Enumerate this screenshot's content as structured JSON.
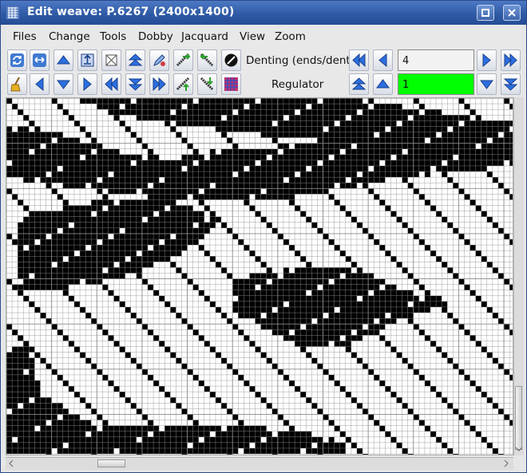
{
  "window": {
    "title": "Edit weave: P.6267 (2400x1400)",
    "app_icon": "loom-icon",
    "controls": [
      "restore-icon",
      "close-icon"
    ]
  },
  "menu": {
    "items": [
      "Files",
      "Change",
      "Tools",
      "Dobby",
      "Jacquard",
      "View",
      "Zoom"
    ]
  },
  "toolbar": {
    "row1_tools": [
      "refresh-icon",
      "fit-width-icon",
      "arrow-up-icon",
      "upload-icon",
      "crop-icon",
      "double-up-icon",
      "pencil-icon",
      "shift-right-icon",
      "shift-left-icon",
      "no-entry-icon"
    ],
    "row2_tools": [
      "broom-icon",
      "arrow-left-icon",
      "arrow-down-icon",
      "arrow-right-icon",
      "double-left-icon",
      "double-down-icon",
      "double-right-icon",
      "shift-up-icon",
      "shift-down-icon",
      "pattern-grid-icon"
    ],
    "denting": {
      "label": "Denting (ends/dent)",
      "value": "4"
    },
    "regulator": {
      "label": "Regulator",
      "value": "1",
      "value_color": "#00ff00"
    }
  },
  "weave": {
    "cell_color_on": "#000000",
    "cell_color_off": "#ffffff",
    "grid_color": "#8a8a8a"
  }
}
